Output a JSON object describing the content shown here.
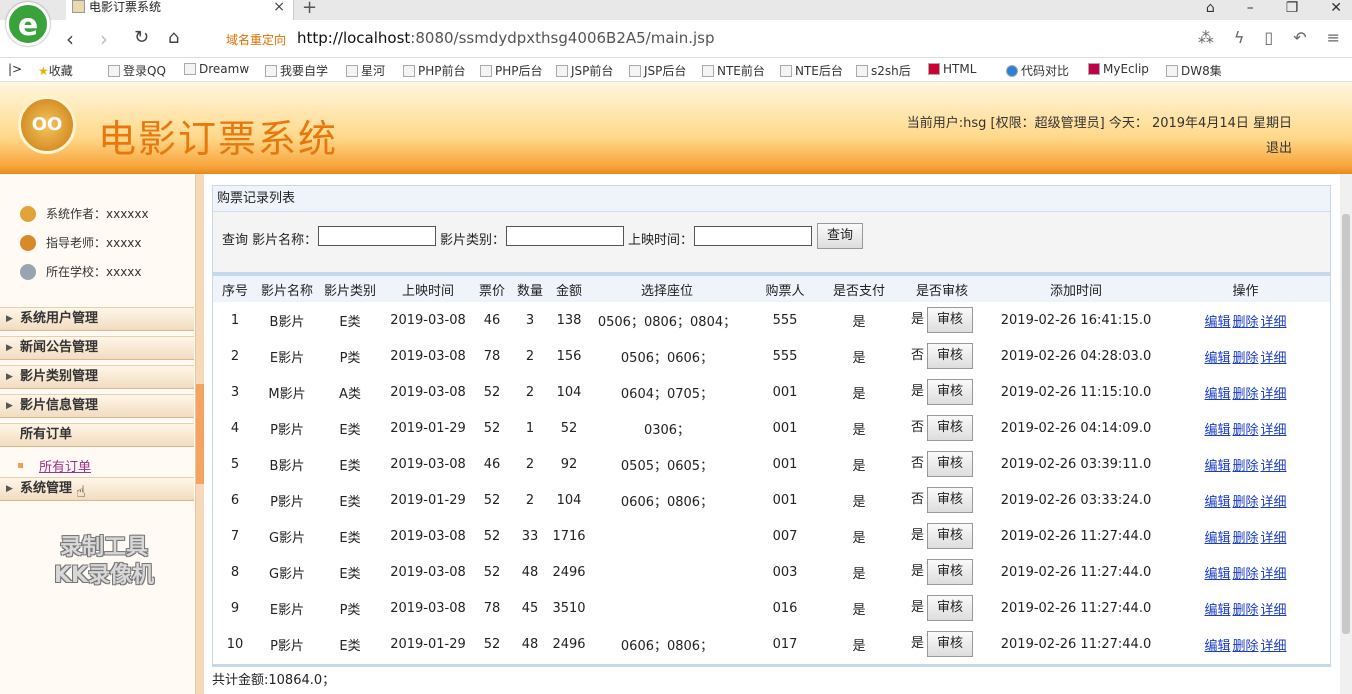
{
  "browser": {
    "tab_title": "电影订票系统",
    "redirect_label": "域名重定向",
    "url_host": "http://localhost",
    "url_rest": ":8080/ssmdydpxthsg4006B2A5/main.jsp",
    "bookmarks": [
      "收藏",
      "登录QQ",
      "Dreamw",
      "我要自学",
      "星河",
      "PHP前台",
      "PHP后台",
      "JSP前台",
      "JSP后台",
      "NTE前台",
      "NTE后台",
      "s2sh后",
      "HTML",
      "代码对比",
      "MyEclip",
      "DW8集"
    ]
  },
  "header": {
    "title": "电影订票系统",
    "user_info": "当前用户:hsg [权限：超级管理员] 今天： 2019年4月14日 星期日",
    "logout": "退出"
  },
  "sidebar": {
    "info": [
      {
        "label": "系统作者：xxxxxx",
        "color": "#e2a33a"
      },
      {
        "label": "指导老师：xxxxx",
        "color": "#d9882a"
      },
      {
        "label": "所在学校：xxxxx",
        "color": "#9aa4b0"
      }
    ],
    "menu": [
      "系统用户管理",
      "新闻公告管理",
      "影片类别管理",
      "影片信息管理",
      "所有订单",
      "系统管理"
    ],
    "submenu": "所有订单",
    "watermark": [
      "录制工具",
      "KK录像机"
    ]
  },
  "panel": {
    "title": "购票记录列表",
    "search": {
      "label_query": "查询 影片名称：",
      "label_category": "影片类别：",
      "label_time": "上映时间：",
      "button": "查询"
    },
    "columns": [
      "序号",
      "影片名称",
      "影片类别",
      "上映时间",
      "票价",
      "数量",
      "金额",
      "选择座位",
      "购票人",
      "是否支付",
      "是否审核",
      "添加时间",
      "操作"
    ],
    "rows": [
      [
        "1",
        "B影片",
        "E类",
        "2019-03-08",
        "46",
        "3",
        "138",
        "0506；0806；0804；",
        "555",
        "是",
        "是",
        "2019-02-26 16:41:15.0"
      ],
      [
        "2",
        "E影片",
        "P类",
        "2019-03-08",
        "78",
        "2",
        "156",
        "0506；0606；",
        "555",
        "是",
        "否",
        "2019-02-26 04:28:03.0"
      ],
      [
        "3",
        "M影片",
        "A类",
        "2019-03-08",
        "52",
        "2",
        "104",
        "0604；0705；",
        "001",
        "是",
        "是",
        "2019-02-26 11:15:10.0"
      ],
      [
        "4",
        "P影片",
        "E类",
        "2019-01-29",
        "52",
        "1",
        "52",
        "0306；",
        "001",
        "是",
        "否",
        "2019-02-26 04:14:09.0"
      ],
      [
        "5",
        "B影片",
        "E类",
        "2019-03-08",
        "46",
        "2",
        "92",
        "0505；0605；",
        "001",
        "是",
        "否",
        "2019-02-26 03:39:11.0"
      ],
      [
        "6",
        "P影片",
        "E类",
        "2019-01-29",
        "52",
        "2",
        "104",
        "0606；0806；",
        "001",
        "是",
        "否",
        "2019-02-26 03:33:24.0"
      ],
      [
        "7",
        "G影片",
        "E类",
        "2019-03-08",
        "52",
        "33",
        "1716",
        "",
        "007",
        "是",
        "是",
        "2019-02-26 11:27:44.0"
      ],
      [
        "8",
        "G影片",
        "E类",
        "2019-03-08",
        "52",
        "48",
        "2496",
        "",
        "003",
        "是",
        "是",
        "2019-02-26 11:27:44.0"
      ],
      [
        "9",
        "E影片",
        "P类",
        "2019-03-08",
        "78",
        "45",
        "3510",
        "",
        "016",
        "是",
        "是",
        "2019-02-26 11:27:44.0"
      ],
      [
        "10",
        "P影片",
        "E类",
        "2019-01-29",
        "52",
        "48",
        "2496",
        "0606；0806；",
        "017",
        "是",
        "是",
        "2019-02-26 11:27:44.0"
      ]
    ],
    "audit_button": "审核",
    "ops": [
      "编辑",
      "删除",
      "详细"
    ],
    "total": "共计金额:10864.0；"
  }
}
